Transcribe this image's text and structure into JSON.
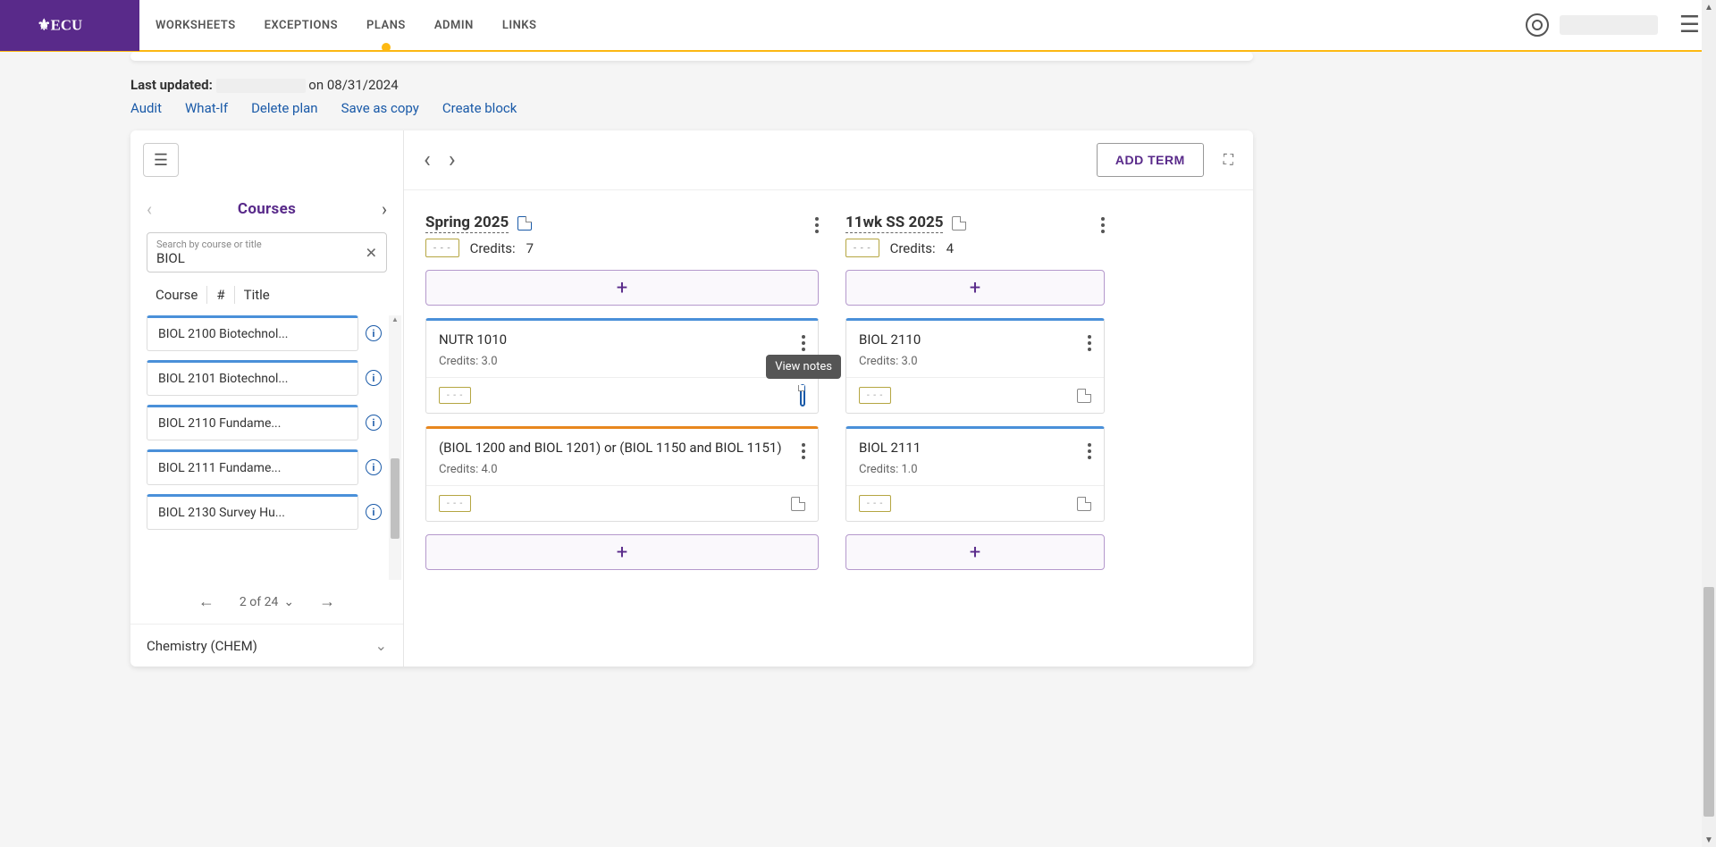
{
  "logo_text": "ECU",
  "nav": {
    "worksheets": "WORKSHEETS",
    "exceptions": "EXCEPTIONS",
    "plans": "PLANS",
    "admin": "ADMIN",
    "links": "LINKS"
  },
  "meta": {
    "last_updated_label": "Last updated:",
    "on_date": "on 08/31/2024"
  },
  "actions": {
    "audit": "Audit",
    "whatif": "What-If",
    "delete": "Delete plan",
    "saveas": "Save as copy",
    "create": "Create block"
  },
  "sidebar": {
    "courses_title": "Courses",
    "search_placeholder": "Search by course or title",
    "search_value": "BIOL",
    "filter_course": "Course",
    "filter_num": "#",
    "filter_title": "Title",
    "courses": [
      "BIOL 2100 Biotechnol...",
      "BIOL 2101 Biotechnol...",
      "BIOL 2110 Fundame...",
      "BIOL 2111 Fundame...",
      "BIOL 2130 Survey Hu..."
    ],
    "pager_text": "2 of 24",
    "subject_row": "Chemistry (CHEM)"
  },
  "planner": {
    "add_term": "ADD TERM",
    "credits_label": "Credits:",
    "badge": "- - -",
    "tooltip": "View notes",
    "terms": [
      {
        "title": "Spring 2025",
        "credits": "7",
        "courses": [
          {
            "title": "NUTR 1010",
            "credits": "Credits: 3.0",
            "accent": "blue",
            "note_active": true
          },
          {
            "title": "(BIOL 1200 and BIOL 1201) or (BIOL 1150 and BIOL 1151)",
            "credits": "Credits: 4.0",
            "accent": "orange",
            "note_active": false
          }
        ]
      },
      {
        "title": "11wk SS 2025",
        "credits": "4",
        "courses": [
          {
            "title": "BIOL 2110",
            "credits": "Credits: 3.0",
            "accent": "blue",
            "note_active": false
          },
          {
            "title": "BIOL 2111",
            "credits": "Credits: 1.0",
            "accent": "blue",
            "note_active": false
          }
        ]
      }
    ]
  }
}
